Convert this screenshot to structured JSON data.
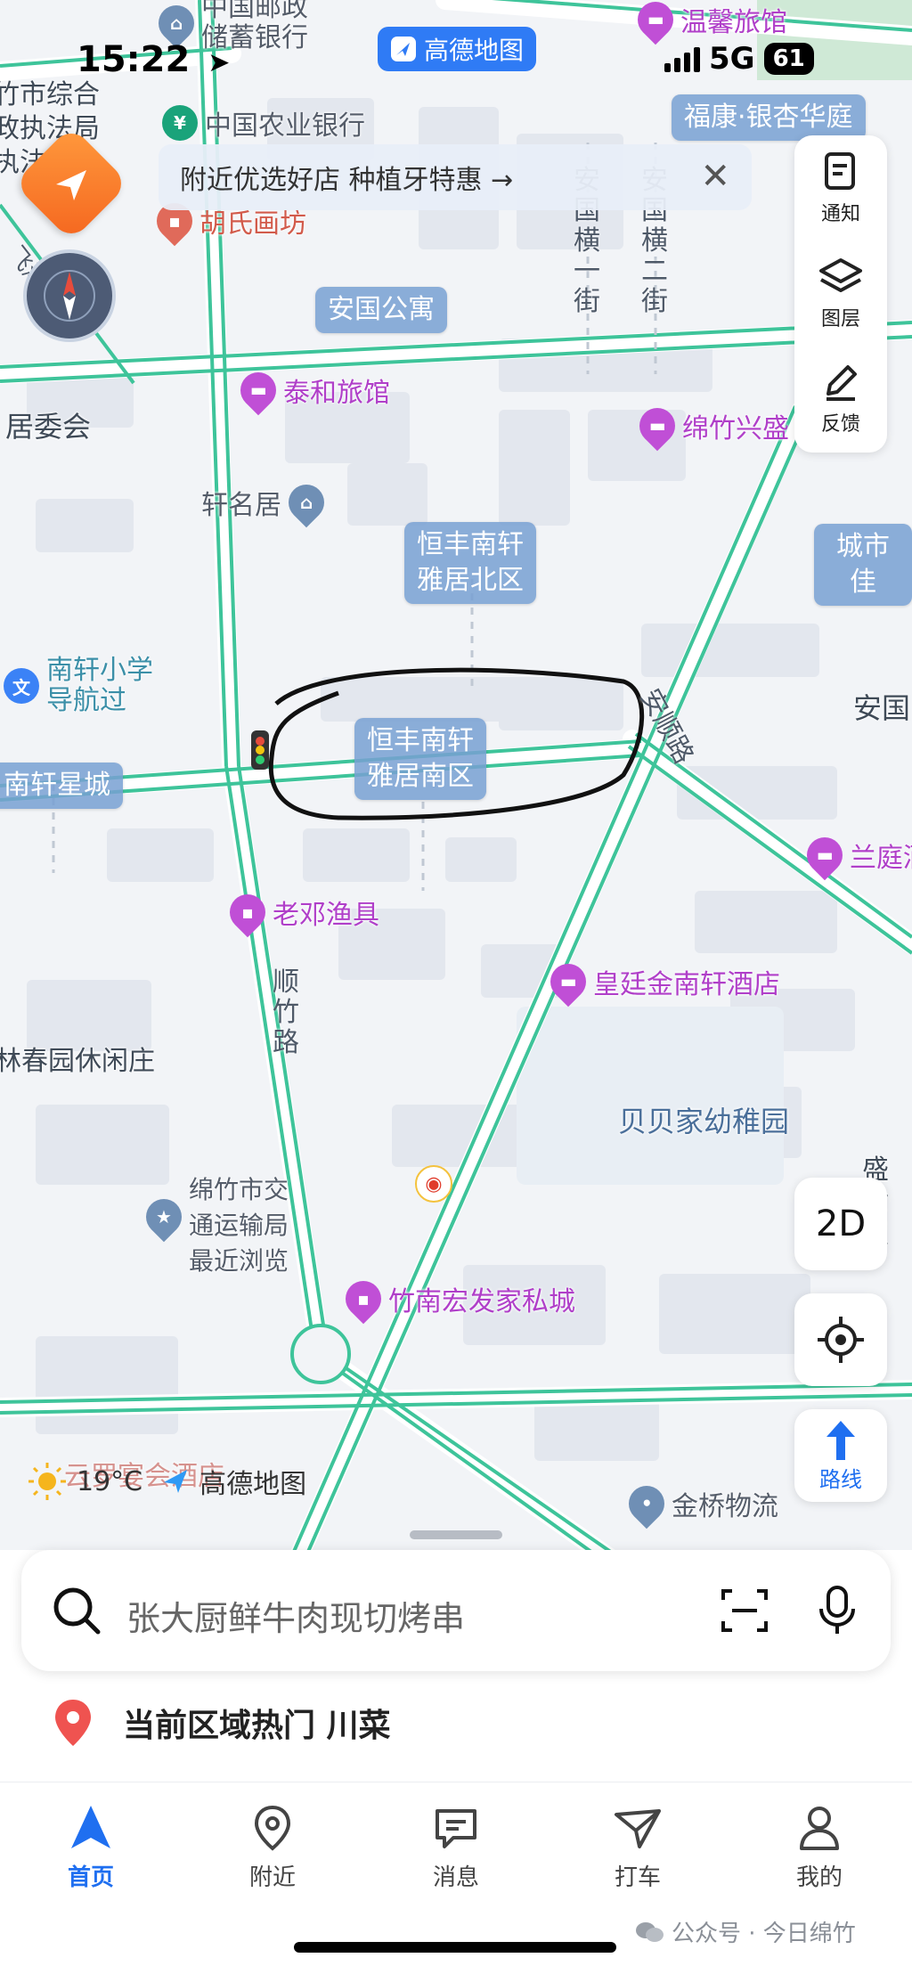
{
  "status": {
    "time": "15:22",
    "app_badge": "高德地图",
    "network": "5G",
    "battery": "61"
  },
  "notice": {
    "text": "附近优选好店 种植牙特惠 →"
  },
  "tools": {
    "notify": "通知",
    "layers": "图层",
    "feedback": "反馈"
  },
  "map_controls": {
    "view_mode": "2D",
    "route": "路线"
  },
  "map": {
    "pois": {
      "postal_bank": "中国邮政\n储蓄银行",
      "abc": "中国农业银行",
      "wenxin": "温馨旅馆",
      "hu_painting": "胡氏画坊",
      "taihe": "泰和旅馆",
      "xuanmingju": "轩名居",
      "mianzhu_xingsheng": "绵竹兴盛",
      "nanxuan_school": "南轩小学\n导航过",
      "laodeng": "老邓渔具",
      "huangting": "皇廷金南轩酒店",
      "lanting": "兰庭酒",
      "jiaotong": "绵竹市交\n通运输局\n最近浏览",
      "zhunan": "竹南宏发家私城",
      "jinqiao": "金桥物流",
      "yunluo": "云罗宴会酒店"
    },
    "labels": {
      "fukang": "福康·银杏华庭",
      "anguo_apt": "安国公寓",
      "hengfeng_north": "恒丰南轩\n雅居北区",
      "hengfeng_south": "恒丰南轩\n雅居南区",
      "nanxuan_xingcheng": "南轩星城",
      "chengshi": "城市佳"
    },
    "areas": {
      "city_law": "竹市综合\n政执法局\n执法",
      "residents": "居委会",
      "anguo": "安国",
      "chunyuan": "林春园休闲庄",
      "beibei": "贝贝家幼稚园",
      "shengshi": "盛世\n置"
    },
    "roads": {
      "anguo_heng1": "安\n国\n横\n一\n街",
      "anguo_heng2": "安\n国\n横\n二\n街",
      "shunzhu": "顺\n竹\n路",
      "anshun": "安顺路",
      "feihong": "飞鸿路"
    }
  },
  "weather": {
    "temp": "19°C",
    "logo": "高德地图"
  },
  "search": {
    "placeholder": "张大厨鲜牛肉现切烤串"
  },
  "hot": {
    "text": "当前区域热门 川菜"
  },
  "tabs": [
    {
      "label": "首页"
    },
    {
      "label": "附近"
    },
    {
      "label": "消息"
    },
    {
      "label": "打车"
    },
    {
      "label": "我的"
    }
  ],
  "watermark": "公众号 · 今日绵竹",
  "colors": {
    "accent": "#1f6ff0",
    "road": "#3ec49a",
    "poi": "#c04fd6"
  }
}
